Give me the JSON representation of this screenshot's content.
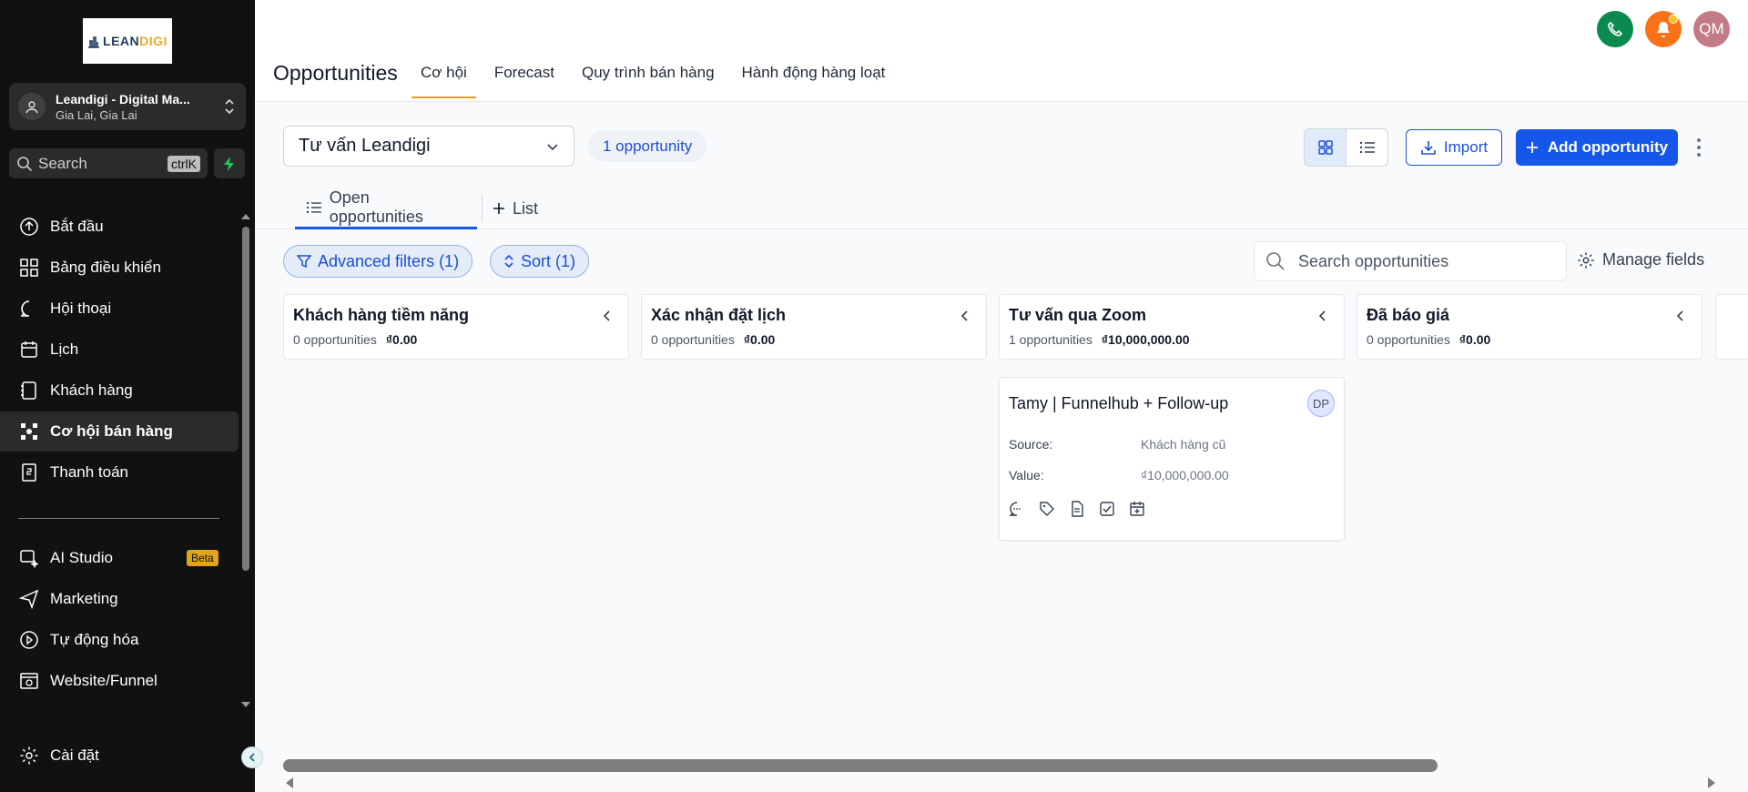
{
  "brand": {
    "logo_part1": "LEAN",
    "logo_part2": "DIGI",
    "logo_accent": "#f5a623"
  },
  "account": {
    "name": "Leandigi - Digital Ma...",
    "location": "Gia Lai, Gia Lai"
  },
  "sidebar_search": {
    "label": "Search",
    "shortcut": "ctrlK"
  },
  "nav": {
    "items": [
      {
        "label": "Bắt đầu",
        "icon": "rocket-icon"
      },
      {
        "label": "Bảng điều khiển",
        "icon": "dashboard-icon"
      },
      {
        "label": "Hội thoại",
        "icon": "chat-icon"
      },
      {
        "label": "Lịch",
        "icon": "calendar-icon"
      },
      {
        "label": "Khách hàng",
        "icon": "contacts-icon"
      },
      {
        "label": "Cơ hội bán hàng",
        "icon": "opportunities-icon"
      },
      {
        "label": "Thanh toán",
        "icon": "payments-icon"
      }
    ],
    "secondary": [
      {
        "label": "AI Studio",
        "icon": "ai-studio-icon",
        "badge": "Beta"
      },
      {
        "label": "Marketing",
        "icon": "send-icon"
      },
      {
        "label": "Tự động hóa",
        "icon": "automation-icon"
      },
      {
        "label": "Website/Funnel",
        "icon": "website-icon"
      }
    ],
    "settings": "Cài đặt"
  },
  "header": {
    "title": "Opportunities",
    "tabs": [
      "Cơ hội",
      "Forecast",
      "Quy trình bán hàng",
      "Hành động hàng loạt"
    ],
    "user_initials": "QM"
  },
  "toolbar": {
    "pipeline": "Tư vấn Leandigi",
    "count": "1 opportunity",
    "import": "Import",
    "add": "Add opportunity"
  },
  "subtabs": {
    "open": "Open opportunities",
    "list": "List"
  },
  "filters": {
    "advanced": "Advanced filters (1)",
    "sort": "Sort (1)",
    "search_placeholder": "Search opportunities",
    "manage": "Manage fields"
  },
  "columns": [
    {
      "title": "Khách hàng tiềm năng",
      "count": "0 opportunities",
      "value": "₫0.00"
    },
    {
      "title": "Xác nhận đặt lịch",
      "count": "0 opportunities",
      "value": "₫0.00"
    },
    {
      "title": "Tư vấn qua Zoom",
      "count": "1 opportunities",
      "value": "₫10,000,000.00"
    },
    {
      "title": "Đã báo giá",
      "count": "0 opportunities",
      "value": "₫0.00"
    }
  ],
  "card": {
    "title": "Tamy | Funnelhub + Follow-up",
    "assignee": "DP",
    "source_label": "Source:",
    "source_value": "Khách hàng cũ",
    "value_label": "Value:",
    "value_value": "₫10,000,000.00"
  }
}
